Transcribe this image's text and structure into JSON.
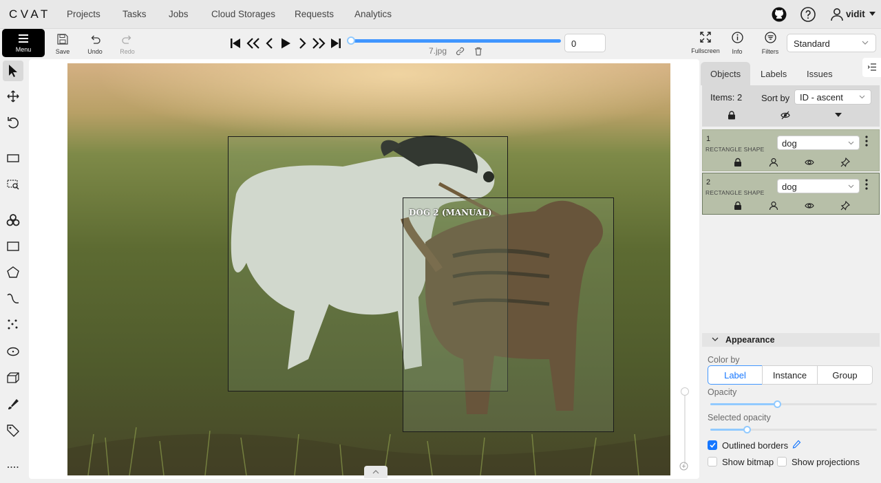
{
  "brand": "CVAT",
  "nav": {
    "items": [
      "Projects",
      "Tasks",
      "Jobs",
      "Cloud Storages",
      "Requests",
      "Analytics"
    ],
    "user": "vidit"
  },
  "toolbar": {
    "menu": "Menu",
    "save": "Save",
    "undo": "Undo",
    "redo": "Redo",
    "fullscreen": "Fullscreen",
    "info": "Info",
    "filters": "Filters",
    "workspace": "Standard",
    "frame_number": "0",
    "filename": "7.jpg",
    "frame_progress": 0
  },
  "canvas": {
    "annotation_label": "DOG 2 (MANUAL)"
  },
  "sidebar": {
    "tabs": [
      "Objects",
      "Labels",
      "Issues"
    ],
    "active_tab": "Objects",
    "items_count": "Items: 2",
    "sort_label": "Sort by",
    "sort_value": "ID - ascent",
    "objects": [
      {
        "id": "1",
        "type": "RECTANGLE SHAPE",
        "label": "dog",
        "color": "#b7bfa8"
      },
      {
        "id": "2",
        "type": "RECTANGLE SHAPE",
        "label": "dog",
        "color": "#b7bfa8"
      }
    ]
  },
  "appearance": {
    "title": "Appearance",
    "color_by": "Color by",
    "options": [
      "Label",
      "Instance",
      "Group"
    ],
    "selected": "Label",
    "opacity_label": "Opacity",
    "opacity": 0.4,
    "selected_opacity_label": "Selected opacity",
    "selected_opacity": 0.22,
    "outlined_borders": "Outlined borders",
    "outlined_checked": true,
    "show_bitmap": "Show bitmap",
    "show_projections": "Show projections"
  },
  "colors": {
    "accent": "#1677ff",
    "object_bg": "#b7bfa8"
  }
}
